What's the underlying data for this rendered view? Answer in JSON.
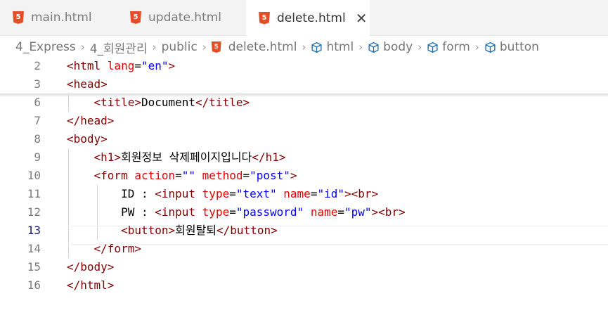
{
  "tabs": [
    {
      "label": "main.html",
      "icon": "html5-icon"
    },
    {
      "label": "update.html",
      "icon": "html5-icon"
    },
    {
      "label": "delete.html",
      "icon": "html5-icon",
      "active": true
    }
  ],
  "close_glyph": "✕",
  "breadcrumb": [
    "4_Express",
    "4_회원관리",
    "public",
    "delete.html",
    "html",
    "body",
    "form",
    "button"
  ],
  "lines": [
    {
      "n": "2",
      "t": [
        [
          "t",
          "<html "
        ],
        [
          "a",
          "lang"
        ],
        [
          "p",
          "="
        ],
        [
          "v",
          "\"en\""
        ],
        [
          "t",
          ">"
        ]
      ]
    },
    {
      "n": "3",
      "t": [
        [
          "t",
          "<head>"
        ]
      ]
    },
    {
      "n": "6",
      "t": [
        [
          "p",
          "    "
        ],
        [
          "t",
          "<title>"
        ],
        [
          "p",
          "Document"
        ],
        [
          "t",
          "</title>"
        ]
      ]
    },
    {
      "n": "7",
      "t": [
        [
          "t",
          "</head>"
        ]
      ]
    },
    {
      "n": "8",
      "t": [
        [
          "t",
          "<body>"
        ]
      ]
    },
    {
      "n": "9",
      "t": [
        [
          "p",
          "    "
        ],
        [
          "t",
          "<h1>"
        ],
        [
          "p",
          "회원정보 삭제페이지입니다"
        ],
        [
          "t",
          "</h1>"
        ]
      ]
    },
    {
      "n": "10",
      "t": [
        [
          "p",
          "    "
        ],
        [
          "t",
          "<form "
        ],
        [
          "a",
          "action"
        ],
        [
          "p",
          "="
        ],
        [
          "v",
          "\"\""
        ],
        [
          "p",
          " "
        ],
        [
          "a",
          "method"
        ],
        [
          "p",
          "="
        ],
        [
          "v",
          "\"post\""
        ],
        [
          "t",
          ">"
        ]
      ]
    },
    {
      "n": "11",
      "t": [
        [
          "p",
          "        ID : "
        ],
        [
          "t",
          "<input "
        ],
        [
          "a",
          "type"
        ],
        [
          "p",
          "="
        ],
        [
          "v",
          "\"text\""
        ],
        [
          "p",
          " "
        ],
        [
          "a",
          "name"
        ],
        [
          "p",
          "="
        ],
        [
          "v",
          "\"id\""
        ],
        [
          "t",
          "><br>"
        ]
      ]
    },
    {
      "n": "12",
      "t": [
        [
          "p",
          "        PW : "
        ],
        [
          "t",
          "<input "
        ],
        [
          "a",
          "type"
        ],
        [
          "p",
          "="
        ],
        [
          "v",
          "\"password\""
        ],
        [
          "p",
          " "
        ],
        [
          "a",
          "name"
        ],
        [
          "p",
          "="
        ],
        [
          "v",
          "\"pw\""
        ],
        [
          "t",
          "><br>"
        ]
      ]
    },
    {
      "n": "13",
      "t": [
        [
          "p",
          "        "
        ],
        [
          "t",
          "<button>"
        ],
        [
          "p",
          "회원탈퇴"
        ],
        [
          "t",
          "</button>"
        ]
      ],
      "current": true
    },
    {
      "n": "14",
      "t": [
        [
          "p",
          "    "
        ],
        [
          "t",
          "</form>"
        ]
      ]
    },
    {
      "n": "15",
      "t": [
        [
          "t",
          "</body>"
        ]
      ]
    },
    {
      "n": "16",
      "t": [
        [
          "t",
          "</html>"
        ]
      ]
    }
  ],
  "colors": {
    "tag": "#800000",
    "attr": "#e50000",
    "value": "#0000ff",
    "html5": "#e44d26",
    "symbol": "#1f6fb3"
  }
}
